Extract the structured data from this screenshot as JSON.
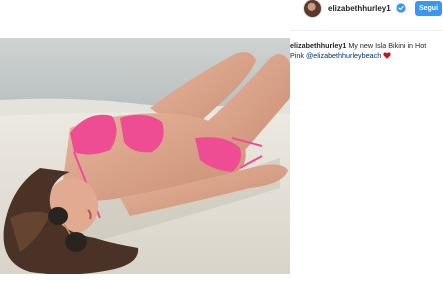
{
  "post": {
    "username": "elizabethhurley1",
    "verified_icon": "verified-badge-icon",
    "follow_label": "Segui",
    "accent_color": "#3897f0",
    "image_alt": "photo",
    "caption": {
      "username": "elizabethhurley1",
      "text": " My new Isla Bikini in Hot Pink ",
      "mention": "@elizabethhurleybeach",
      "emoji_icon": "red-heart-icon",
      "emoji_color": "#c0131a"
    }
  }
}
